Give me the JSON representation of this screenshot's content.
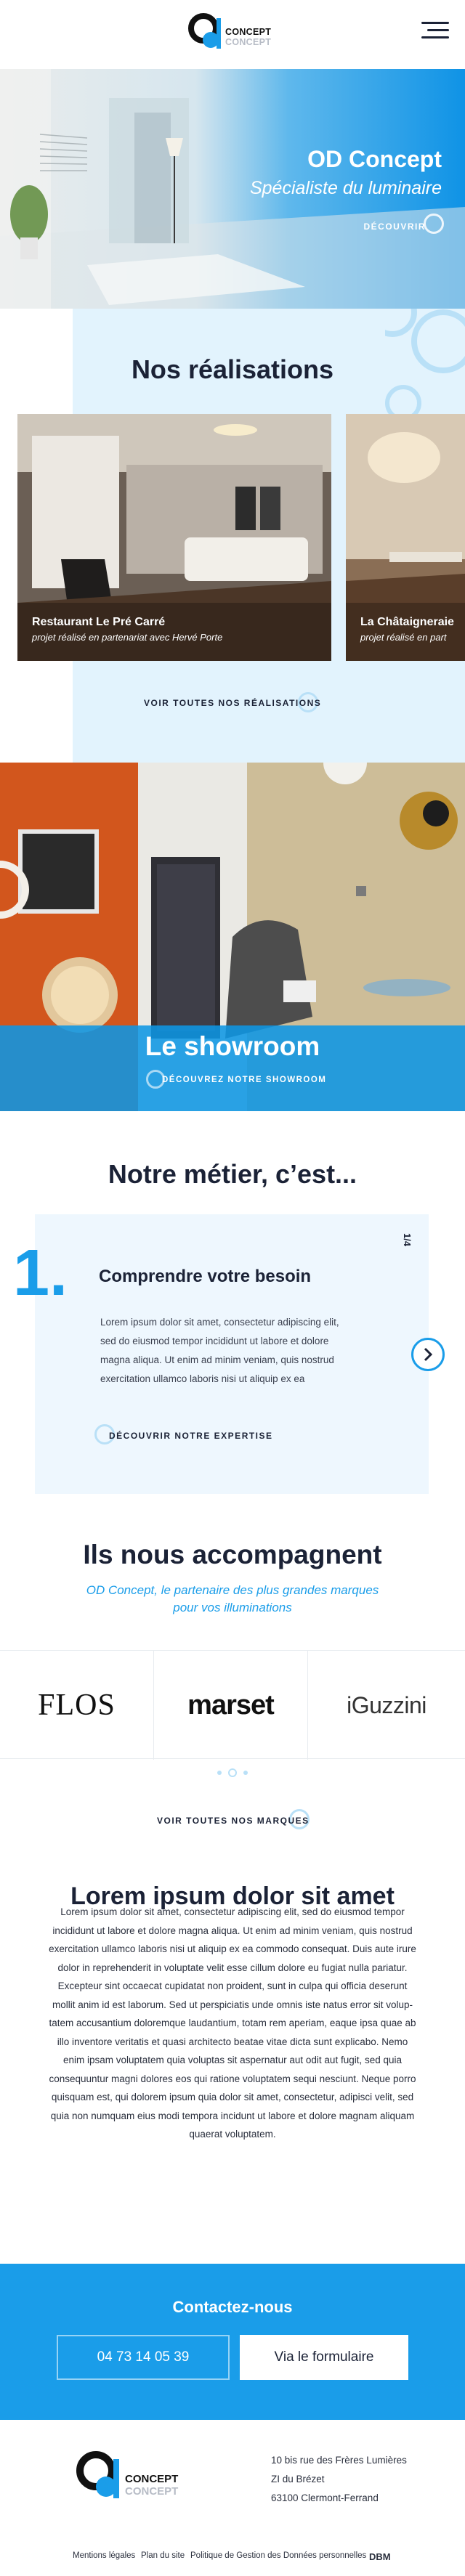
{
  "brand": {
    "name_top": "CONCEPT",
    "name_bottom": "CONCEPT",
    "accent": "#1a9de9",
    "dark": "#1b2236"
  },
  "header": {
    "menu_icon": "hamburger-icon"
  },
  "hero": {
    "title": "OD Concept",
    "subtitle": "Spécialiste du luminaire",
    "cta": "DÉCOUVRIR"
  },
  "realisations": {
    "title": "Nos réalisations",
    "items": [
      {
        "title": "Restaurant Le Pré Carré",
        "subtitle": "projet réalisé en partenariat avec Hervé Porte"
      },
      {
        "title": "La Châtaigneraie",
        "subtitle": "projet réalisé en part"
      }
    ],
    "cta": "VOIR TOUTES NOS RÉALISATIONS"
  },
  "showroom": {
    "title": "Le showroom",
    "cta": "DÉCOUVREZ NOTRE SHOWROOM"
  },
  "metier": {
    "title": "Notre métier, c’est...",
    "counter": "1/4",
    "number": "1.",
    "step_title": "Comprendre votre besoin",
    "text_lines": [
      "Lorem ipsum dolor sit amet, consectetur adipiscing elit,",
      "sed do eiusmod tempor incididunt ut labore et dolore",
      "magna aliqua. Ut enim ad minim veniam, quis nostrud",
      "exercitation ullamco laboris nisi ut aliquip ex ea"
    ],
    "cta": "DÉCOUVRIR NOTRE EXPERTISE"
  },
  "partners": {
    "title": "Ils nous accompagnent",
    "subtitle_line1": "OD Concept, le partenaire des plus grandes marques",
    "subtitle_line2": "pour vos illuminations",
    "brands": [
      "FLOS",
      "marset",
      "iGuzzini"
    ],
    "cta": "VOIR TOUTES NOS MARQUES"
  },
  "lorem": {
    "title": "Lorem ipsum dolor sit amet",
    "lines": [
      "Lorem ipsum dolor sit amet, consectetur adipiscing elit, sed do eiusmod tempor",
      "incididunt ut labore et dolore magna aliqua. Ut enim ad minim veniam, quis nostrud",
      "exercitation ullamco laboris nisi ut aliquip ex ea commodo consequat. Duis aute irure",
      "dolor in reprehenderit in voluptate velit esse cillum dolore eu fugiat nulla pariatur.",
      "Excepteur sint occaecat cupidatat non proident, sunt in culpa qui officia deserunt",
      "mollit anim id est laborum. Sed ut perspiciatis unde omnis iste natus error sit volup-",
      "tatem accusantium doloremque laudantium, totam rem aperiam, eaque ipsa quae ab",
      "illo inventore veritatis et quasi architecto beatae vitae dicta sunt explicabo. Nemo",
      "enim ipsam voluptatem quia voluptas sit aspernatur aut odit aut fugit, sed quia",
      "consequuntur magni dolores eos qui ratione voluptatem sequi nesciunt. Neque porro",
      "quisquam est, qui dolorem ipsum quia dolor sit amet, consectetur, adipisci velit, sed",
      "quia non numquam eius modi tempora incidunt ut labore et dolore magnam aliquam",
      "quaerat voluptatem."
    ]
  },
  "contact": {
    "title": "Contactez-nous",
    "phone": "04 73 14 05 39",
    "form_button": "Via le formulaire"
  },
  "footer": {
    "address": [
      "10 bis rue des Frères Lumières",
      "ZI du Brézet",
      "63100 Clermont-Ferrand"
    ],
    "links": [
      "Mentions légales",
      "Plan du site",
      "Politique de Gestion des Données personnelles"
    ],
    "agency": "DBM"
  }
}
